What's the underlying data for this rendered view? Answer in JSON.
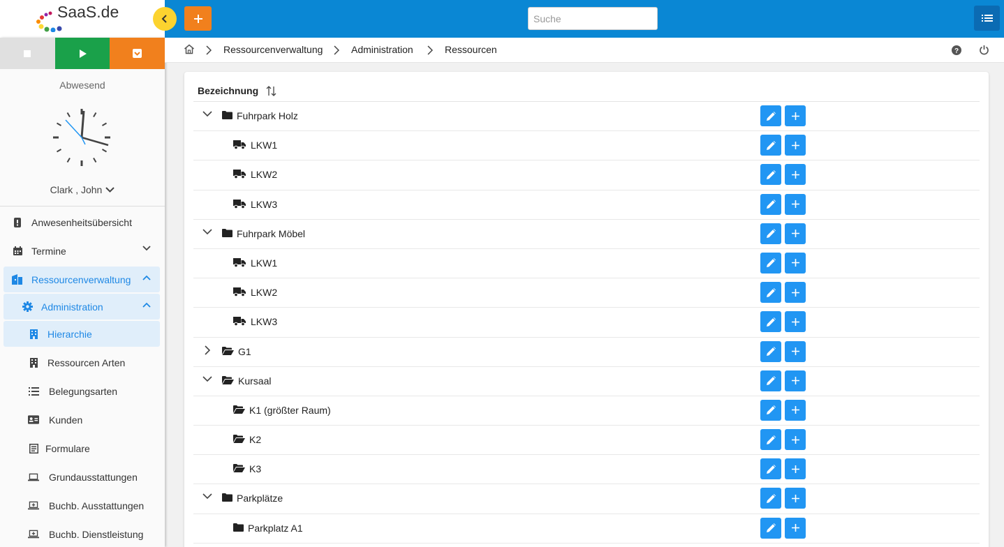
{
  "app": {
    "logo_text": "SaaS.de",
    "search_placeholder": "Suche"
  },
  "sidebar": {
    "status": "Abwesend",
    "user": "Clark , John",
    "nav": [
      {
        "label": "Anwesenheitsübersicht"
      },
      {
        "label": "Termine"
      },
      {
        "label": "Ressourcenverwaltung"
      },
      {
        "label": "Administration"
      },
      {
        "label": "Hierarchie"
      },
      {
        "label": "Ressourcen Arten"
      },
      {
        "label": "Belegungsarten"
      },
      {
        "label": "Kunden"
      },
      {
        "label": "Formulare"
      },
      {
        "label": "Grundausstattungen"
      },
      {
        "label": "Buchb. Ausstattungen"
      },
      {
        "label": "Buchb. Dienstleistung"
      }
    ]
  },
  "breadcrumb": [
    "Ressourcenverwaltung",
    "Administration",
    "Ressourcen"
  ],
  "table": {
    "header": "Bezeichnung",
    "rows": [
      {
        "label": "Fuhrpark Holz",
        "icon": "folder-icon",
        "toggle": "expanded"
      },
      {
        "label": "LKW1",
        "icon": "truck-icon"
      },
      {
        "label": "LKW2",
        "icon": "truck-icon"
      },
      {
        "label": "LKW3",
        "icon": "truck-icon"
      },
      {
        "label": "Fuhrpark Möbel",
        "icon": "folder-icon",
        "toggle": "expanded"
      },
      {
        "label": "LKW1",
        "icon": "truck-icon"
      },
      {
        "label": "LKW2",
        "icon": "truck-icon"
      },
      {
        "label": "LKW3",
        "icon": "truck-icon"
      },
      {
        "label": "G1",
        "icon": "folder-open-icon",
        "toggle": "collapsed"
      },
      {
        "label": "Kursaal",
        "icon": "folder-open-icon",
        "toggle": "expanded"
      },
      {
        "label": "K1 (größter Raum)",
        "icon": "folder-open-icon"
      },
      {
        "label": "K2",
        "icon": "folder-open-icon"
      },
      {
        "label": "K3",
        "icon": "folder-open-icon"
      },
      {
        "label": "Parkplätze",
        "icon": "folder-icon",
        "toggle": "expanded"
      },
      {
        "label": "Parkplatz A1",
        "icon": "folder-icon"
      }
    ]
  },
  "colors": {
    "topbar": "#0a87d4",
    "accent": "#2196f3",
    "orange": "#f1801d",
    "green": "#1aa14a",
    "yellow": "#fcd32f"
  }
}
